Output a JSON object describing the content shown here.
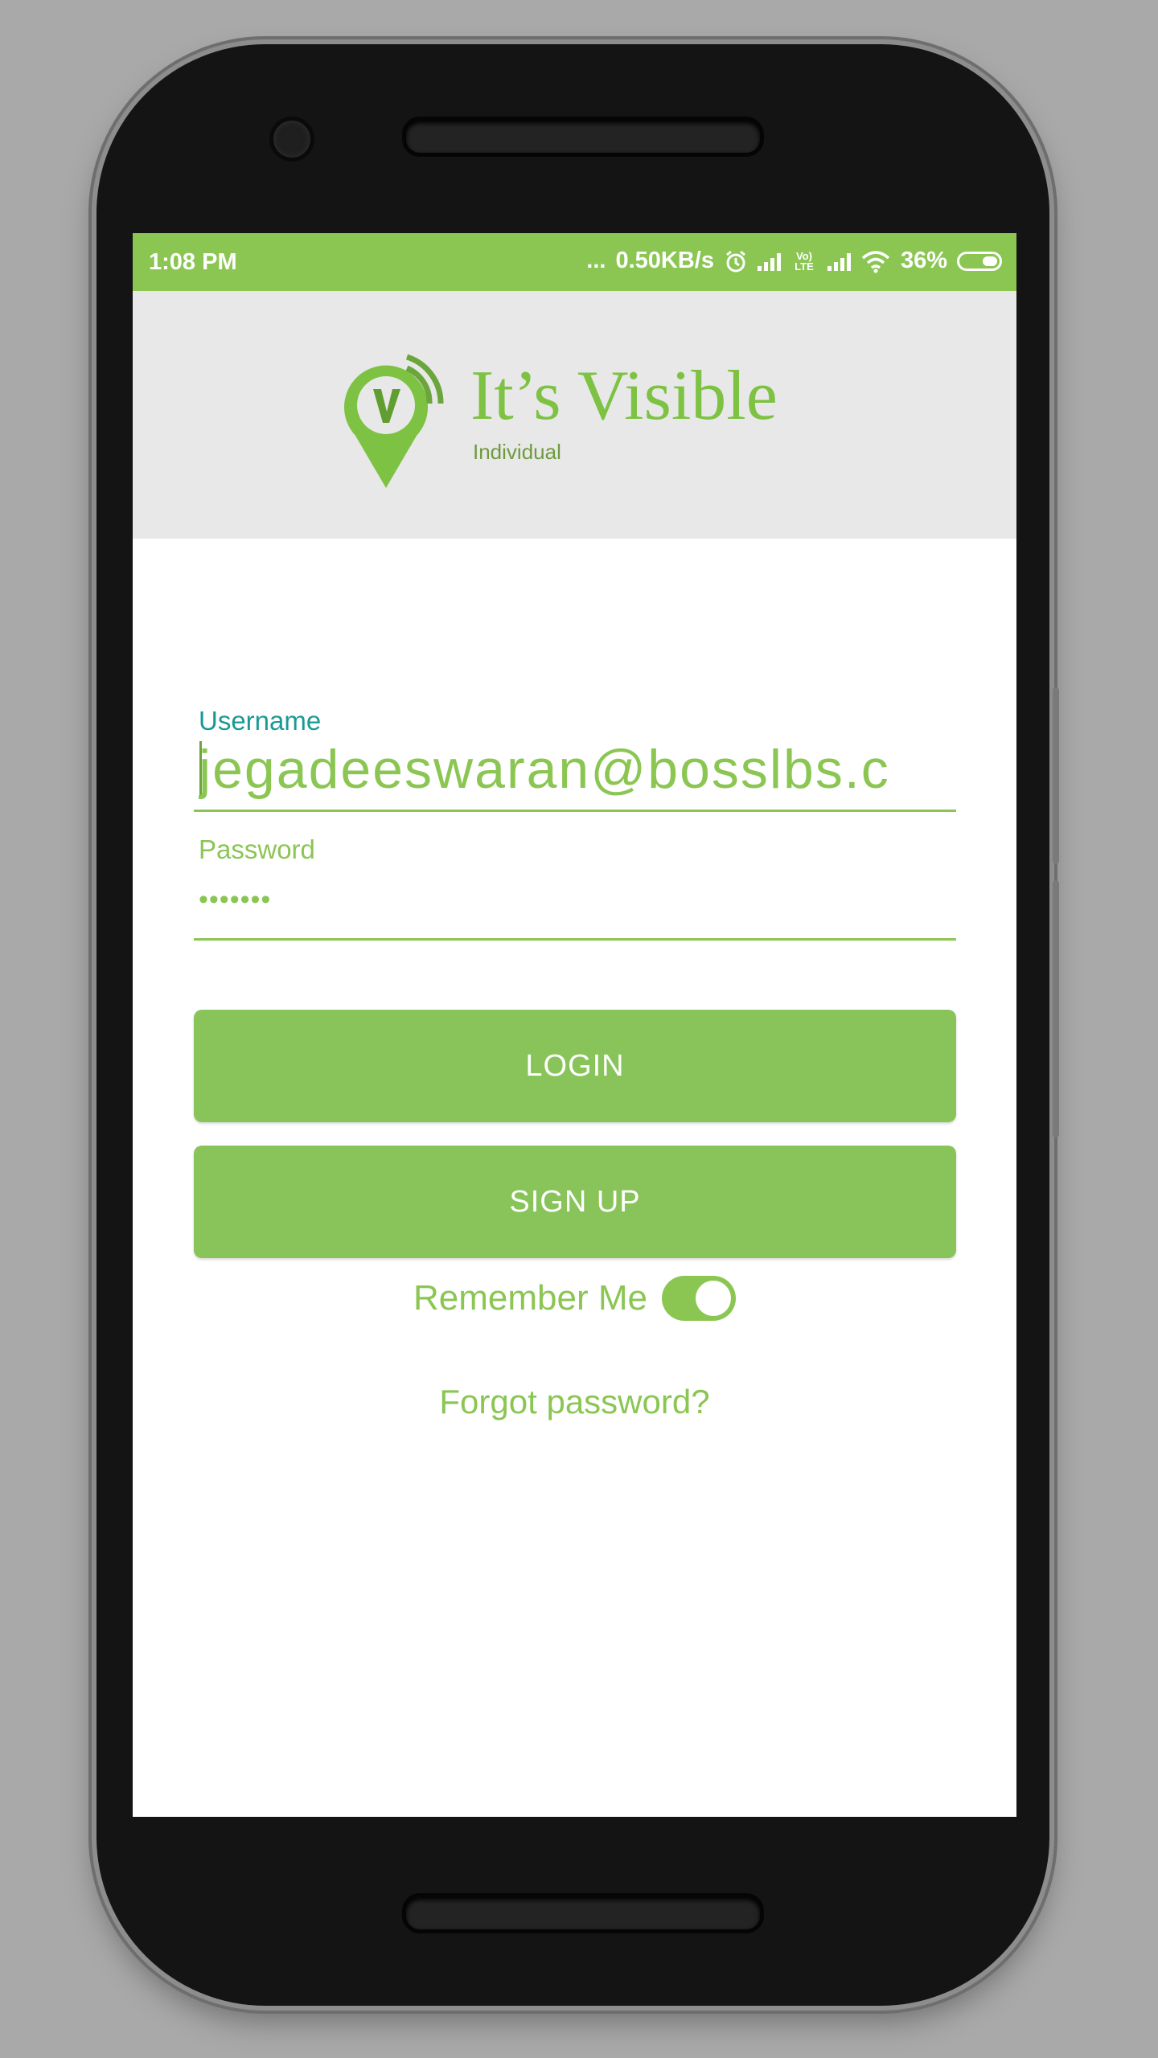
{
  "status_bar": {
    "time": "1:08 PM",
    "dots": "...",
    "network_speed": "0.50KB/s",
    "volte_label": "Vo) LTE",
    "battery_percent": "36%",
    "icons": [
      "alarm-icon",
      "signal-icon",
      "volte-icon",
      "signal-icon",
      "wifi-icon",
      "battery-icon"
    ]
  },
  "header": {
    "logo_text": "It’s Visible",
    "logo_subtitle": "Individual"
  },
  "form": {
    "username_label": "Username",
    "username_value": "jegadeeswaran@bosslbs.c",
    "password_label": "Password",
    "password_value": "•••••••"
  },
  "buttons": {
    "login": "LOGIN",
    "signup": "SIGN UP"
  },
  "remember_me": {
    "label": "Remember Me",
    "enabled": true
  },
  "forgot_password": "Forgot password?",
  "colors": {
    "accent": "#8bc653",
    "label_teal": "#1a9a95",
    "header_bg": "#e8e8e8",
    "device_bg": "#a9a9a9"
  }
}
